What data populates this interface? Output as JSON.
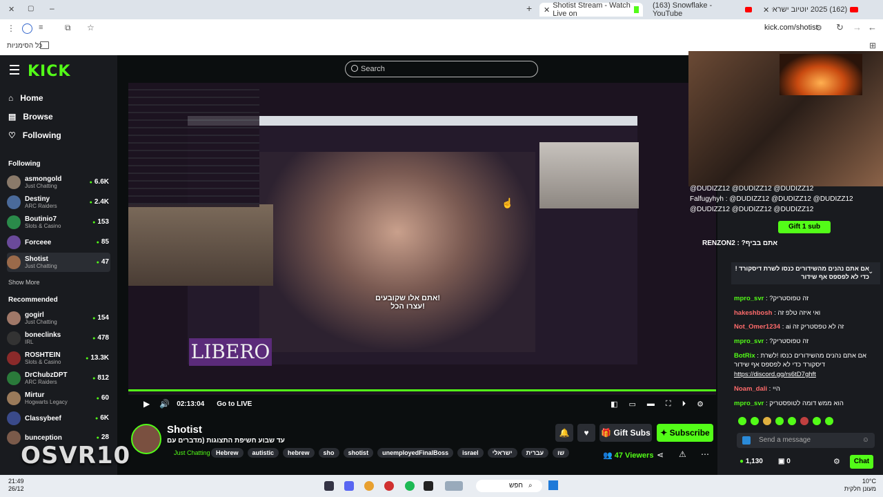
{
  "browser": {
    "tabs": [
      {
        "label": "Shotist Stream - Watch Live on",
        "active": true
      },
      {
        "label": "(163) Snowflake - YouTube",
        "active": false
      },
      {
        "label": "(162) 2025 יוטיוב ישראל טרנדים",
        "active": false
      }
    ],
    "url": "kick.com/shotist",
    "bookmarks_label": "כל הסימניות"
  },
  "kick": {
    "logo": "KICK",
    "search_placeholder": "Search",
    "nav": [
      {
        "label": "Home",
        "icon": "home-icon"
      },
      {
        "label": "Browse",
        "icon": "browse-icon"
      },
      {
        "label": "Following",
        "icon": "heart-icon"
      }
    ],
    "following_title": "Following",
    "following": [
      {
        "name": "asmongold",
        "category": "Just Chatting",
        "viewers": "6.6K"
      },
      {
        "name": "Destiny",
        "category": "ARC Raiders",
        "viewers": "2.4K"
      },
      {
        "name": "Boutinio7",
        "category": "Slots & Casino",
        "viewers": "153"
      },
      {
        "name": "Forceee",
        "category": "",
        "viewers": "85"
      },
      {
        "name": "Shotist",
        "category": "Just Chatting",
        "viewers": "47"
      }
    ],
    "show_more": "Show More",
    "recommended_title": "Recommended",
    "recommended": [
      {
        "name": "gogirl",
        "category": "Just Chatting",
        "viewers": "154"
      },
      {
        "name": "boneclinks",
        "category": "IRL",
        "viewers": "478"
      },
      {
        "name": "ROSHTEIN",
        "category": "Slots & Casino",
        "viewers": "13.3K"
      },
      {
        "name": "DrChubzDPT",
        "category": "ARC Raiders",
        "viewers": "812"
      },
      {
        "name": "Mirtur",
        "category": "Hogwarts Legacy",
        "viewers": "60"
      },
      {
        "name": "Classybeef",
        "category": "",
        "viewers": "6K"
      },
      {
        "name": "bunception",
        "category": "",
        "viewers": "28"
      }
    ]
  },
  "video": {
    "caption": "!אתם אלו שקובעים\n!עצרו הכל",
    "libero": "LIBERO",
    "time": "02:13:04",
    "go_live": "Go to LIVE"
  },
  "stream": {
    "name": "Shotist",
    "title": "עד שבוע חשיפת התצוגות (מדברים עם",
    "category": "Just Chatting",
    "tags": [
      "Hebrew",
      "autistic",
      "hebrew",
      "sho",
      "shotist",
      "unemployedFinalBoss",
      "israel",
      "ישראלי",
      "עברית",
      "שו"
    ],
    "gift_subs": "Gift Subs",
    "subscribe": "Subscribe",
    "viewers": "47 Viewers"
  },
  "overlay": {
    "text": "OSVR10"
  },
  "chat": {
    "mentions": [
      "@DUDIZZ12 @DUDIZZ12 @DUDIZZ12",
      "Falfugyhyh : @DUDIZZ12 @DUDIZZ12 @DUDIZZ12",
      "@DUDIZZ12 @DUDIZZ12 @DUDIZZ12"
    ],
    "gift_sub": "Gift 1 sub",
    "renzo": "RENZON2 : ?אתם בביף",
    "pinned": "אם אתם נהנים מהשידורים כנסו לשרת דיסקורד !כדי לא לפספס אף שידור",
    "messages": [
      {
        "user": "mpro_svr",
        "text": "?זה טפוסטריק",
        "color": "#53fc18"
      },
      {
        "user": "hakeshbosh",
        "text": "ואי איזה טלפ זה",
        "color": "#ff6b6b"
      },
      {
        "user": "Not_Omer1234",
        "text": "ai זה לא טפסטריק זה",
        "color": "#ff6b6b"
      },
      {
        "user": "mpro_svr",
        "text": "?זה טפוסטריק",
        "color": "#53fc18"
      },
      {
        "user": "BotRix",
        "text": "אם אתם נהנים מהשידורים כנסו !לשרת דיסקורד כדי לא לפספס אף שידור",
        "color": "#53fc18"
      },
      {
        "user": "",
        "text": "https://discord.gg/rs6tD7ghft",
        "color": "#ffffff"
      },
      {
        "user": "Noam_dali",
        "text": "היי",
        "color": "#ff6b6b"
      },
      {
        "user": "mpro_svr",
        "text": "הוא ממש דומה לטופסטריק",
        "color": "#53fc18"
      }
    ],
    "send_placeholder": "Send a message",
    "points": "1,130",
    "count": "0",
    "chat_button": "Chat"
  },
  "taskbar": {
    "time": "21:49",
    "date": "26/12",
    "search": "חפש",
    "weather": "10°C",
    "weather_desc": "מעונן חלקית"
  }
}
